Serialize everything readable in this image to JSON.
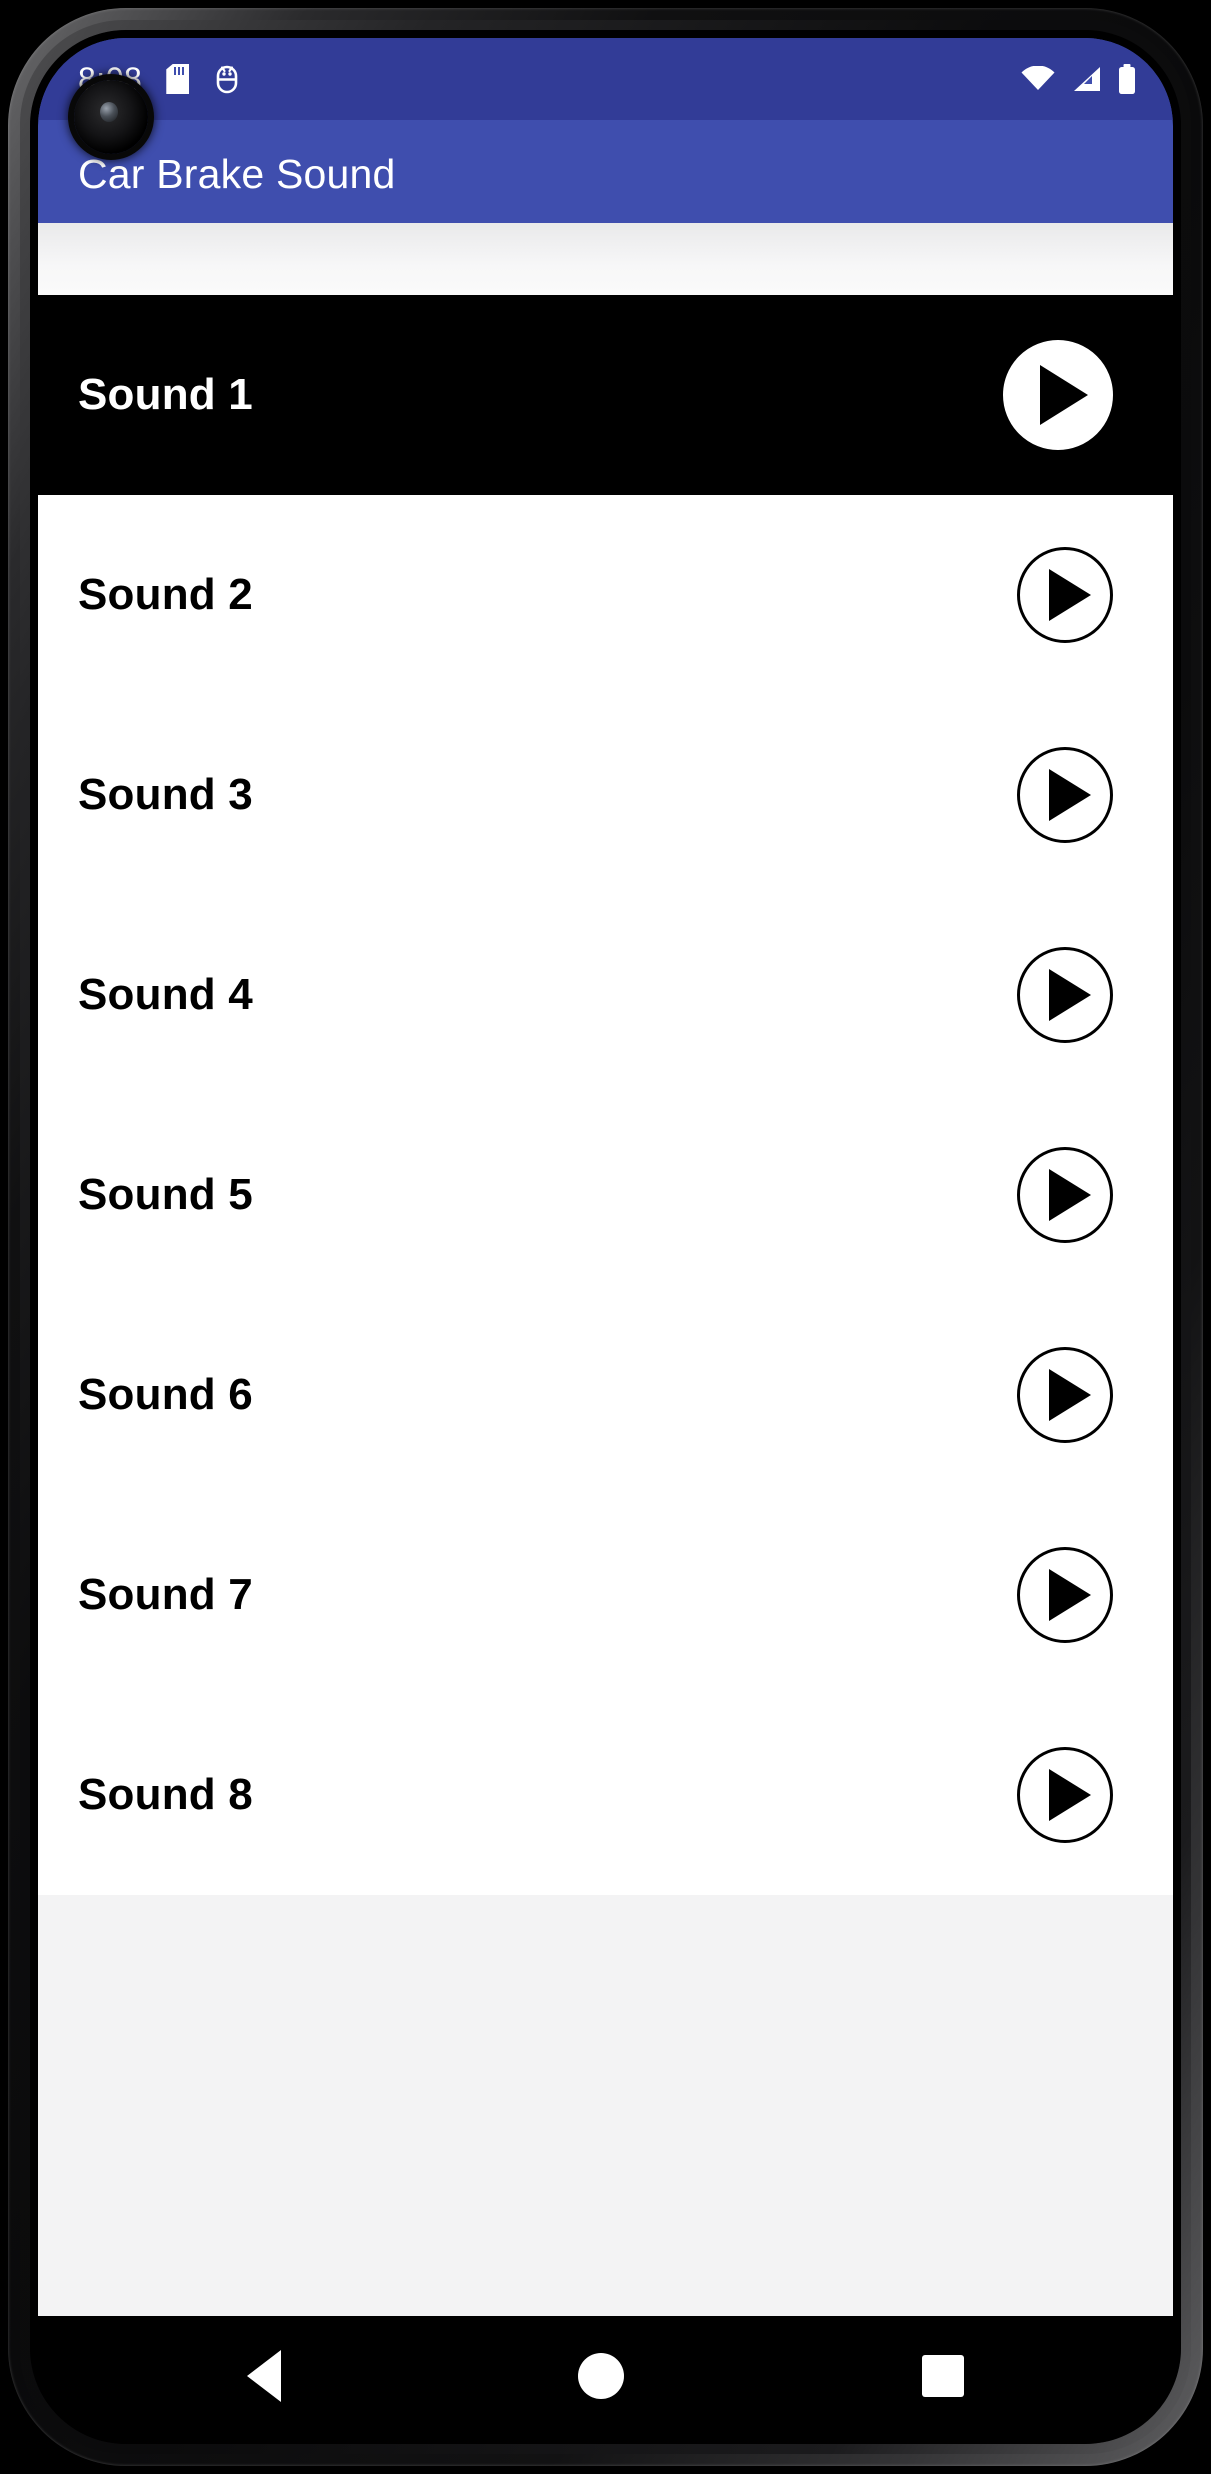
{
  "device": {
    "frame": "android-phone",
    "bezel_color": "#000000"
  },
  "statusbar": {
    "time": "8:08",
    "icons_left": [
      "sdcard-icon",
      "android-debug-icon"
    ],
    "icons_right": [
      "wifi-icon",
      "signal-icon",
      "battery-icon"
    ]
  },
  "appbar": {
    "title": "Car Brake Sound",
    "background_color": "#3f4eae"
  },
  "list": {
    "items": [
      {
        "label": "Sound 1",
        "selected": true,
        "action": "play-button"
      },
      {
        "label": "Sound 2",
        "selected": false,
        "action": "play-button"
      },
      {
        "label": "Sound 3",
        "selected": false,
        "action": "play-button"
      },
      {
        "label": "Sound 4",
        "selected": false,
        "action": "play-button"
      },
      {
        "label": "Sound 5",
        "selected": false,
        "action": "play-button"
      },
      {
        "label": "Sound 6",
        "selected": false,
        "action": "play-button"
      },
      {
        "label": "Sound 7",
        "selected": false,
        "action": "play-button"
      },
      {
        "label": "Sound 8",
        "selected": false,
        "action": "play-button"
      }
    ]
  },
  "navbar": {
    "buttons": [
      {
        "name": "back-button",
        "icon": "triangle-left-icon"
      },
      {
        "name": "home-button",
        "icon": "circle-icon"
      },
      {
        "name": "recents-button",
        "icon": "square-icon"
      }
    ]
  },
  "colors": {
    "accent": "#3f4eae",
    "accent_dark": "#323c97",
    "selected_row_bg": "#000000",
    "row_bg": "#ffffff",
    "tail_bg": "#f3f3f4"
  }
}
